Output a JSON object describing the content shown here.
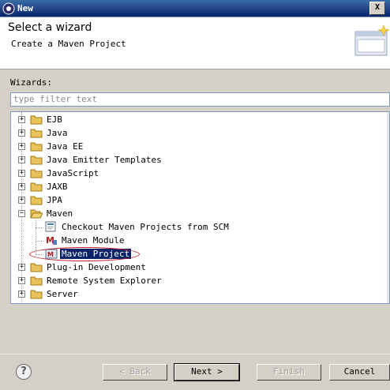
{
  "window": {
    "title": "New",
    "close_label": "X"
  },
  "header": {
    "title": "Select a wizard",
    "description": "Create a Maven Project"
  },
  "wizards_label": "Wizards:",
  "filter": {
    "placeholder": "type filter text",
    "value": ""
  },
  "tree": {
    "items": [
      {
        "label": "EJB",
        "kind": "folder",
        "expanded": false
      },
      {
        "label": "Java",
        "kind": "folder",
        "expanded": false
      },
      {
        "label": "Java EE",
        "kind": "folder",
        "expanded": false
      },
      {
        "label": "Java Emitter Templates",
        "kind": "folder",
        "expanded": false
      },
      {
        "label": "JavaScript",
        "kind": "folder",
        "expanded": false
      },
      {
        "label": "JAXB",
        "kind": "folder",
        "expanded": false
      },
      {
        "label": "JPA",
        "kind": "folder",
        "expanded": false
      },
      {
        "label": "Maven",
        "kind": "folder",
        "expanded": true
      },
      {
        "label": "Checkout Maven Projects from SCM",
        "kind": "item"
      },
      {
        "label": "Maven Module",
        "kind": "item"
      },
      {
        "label": "Maven Project",
        "kind": "item",
        "selected": true
      },
      {
        "label": "Plug-in Development",
        "kind": "folder",
        "expanded": false
      },
      {
        "label": "Remote System Explorer",
        "kind": "folder",
        "expanded": false
      },
      {
        "label": "Server",
        "kind": "folder",
        "expanded": false
      }
    ]
  },
  "buttons": {
    "help": "?",
    "back": "< Back",
    "next": "Next >",
    "finish": "Finish",
    "cancel": "Cancel"
  },
  "colors": {
    "selection": "#0a246a",
    "highlight_ellipse": "#c0202a",
    "folder": "#e8c25a"
  }
}
